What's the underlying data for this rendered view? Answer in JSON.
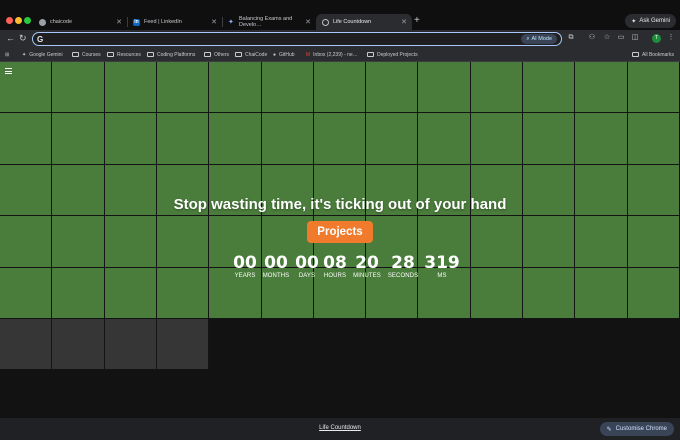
{
  "browser": {
    "tabs": [
      {
        "title": "chaicode",
        "favicon_color": "#9aa0a6"
      },
      {
        "title": "Feed | LinkedIn",
        "favicon_color": "#0a66c2"
      },
      {
        "title": "Balancing Exams and Develo…",
        "favicon_color": "#8ab4f8"
      },
      {
        "title": "Life Countdown",
        "favicon_color": "#bdc1c6"
      }
    ],
    "ask_gemini_label": "Ask Gemini",
    "address_value": "",
    "ai_mode_label": "AI Mode",
    "profile_initial": "T",
    "bookmarks": [
      {
        "label": "Google Gemini"
      },
      {
        "label": "Courses"
      },
      {
        "label": "Resources"
      },
      {
        "label": "Coding Platforms"
      },
      {
        "label": "Others"
      },
      {
        "label": "ChaiCode"
      },
      {
        "label": "GitHub"
      },
      {
        "label": "Inbox (2,239) - ne…"
      },
      {
        "label": "Deployed Projects"
      }
    ],
    "all_bookmarks_label": "All Bookmarks"
  },
  "page": {
    "headline": "Stop wasting time, it's ticking out of your hand",
    "projects_button": "Projects",
    "countdown": [
      {
        "value": "00",
        "label": "YEARS"
      },
      {
        "value": "00",
        "label": "MONTHS"
      },
      {
        "value": "00",
        "label": "DAYS"
      },
      {
        "value": "08",
        "label": "HOURS"
      },
      {
        "value": "20",
        "label": "MINUTES"
      },
      {
        "value": "28",
        "label": "SECONDS"
      },
      {
        "value": "319",
        "label": "MS"
      }
    ],
    "grid": {
      "lived_cells": 65,
      "remaining_cells": 4,
      "lived_color": "#4a7c3b",
      "remaining_color": "#363636"
    }
  },
  "bottom_bar": {
    "link": "Life Countdown",
    "customise_label": "Customise Chrome"
  },
  "colors": {
    "accent_orange": "#f07b2c",
    "chrome_dark": "#2b2c2f"
  }
}
